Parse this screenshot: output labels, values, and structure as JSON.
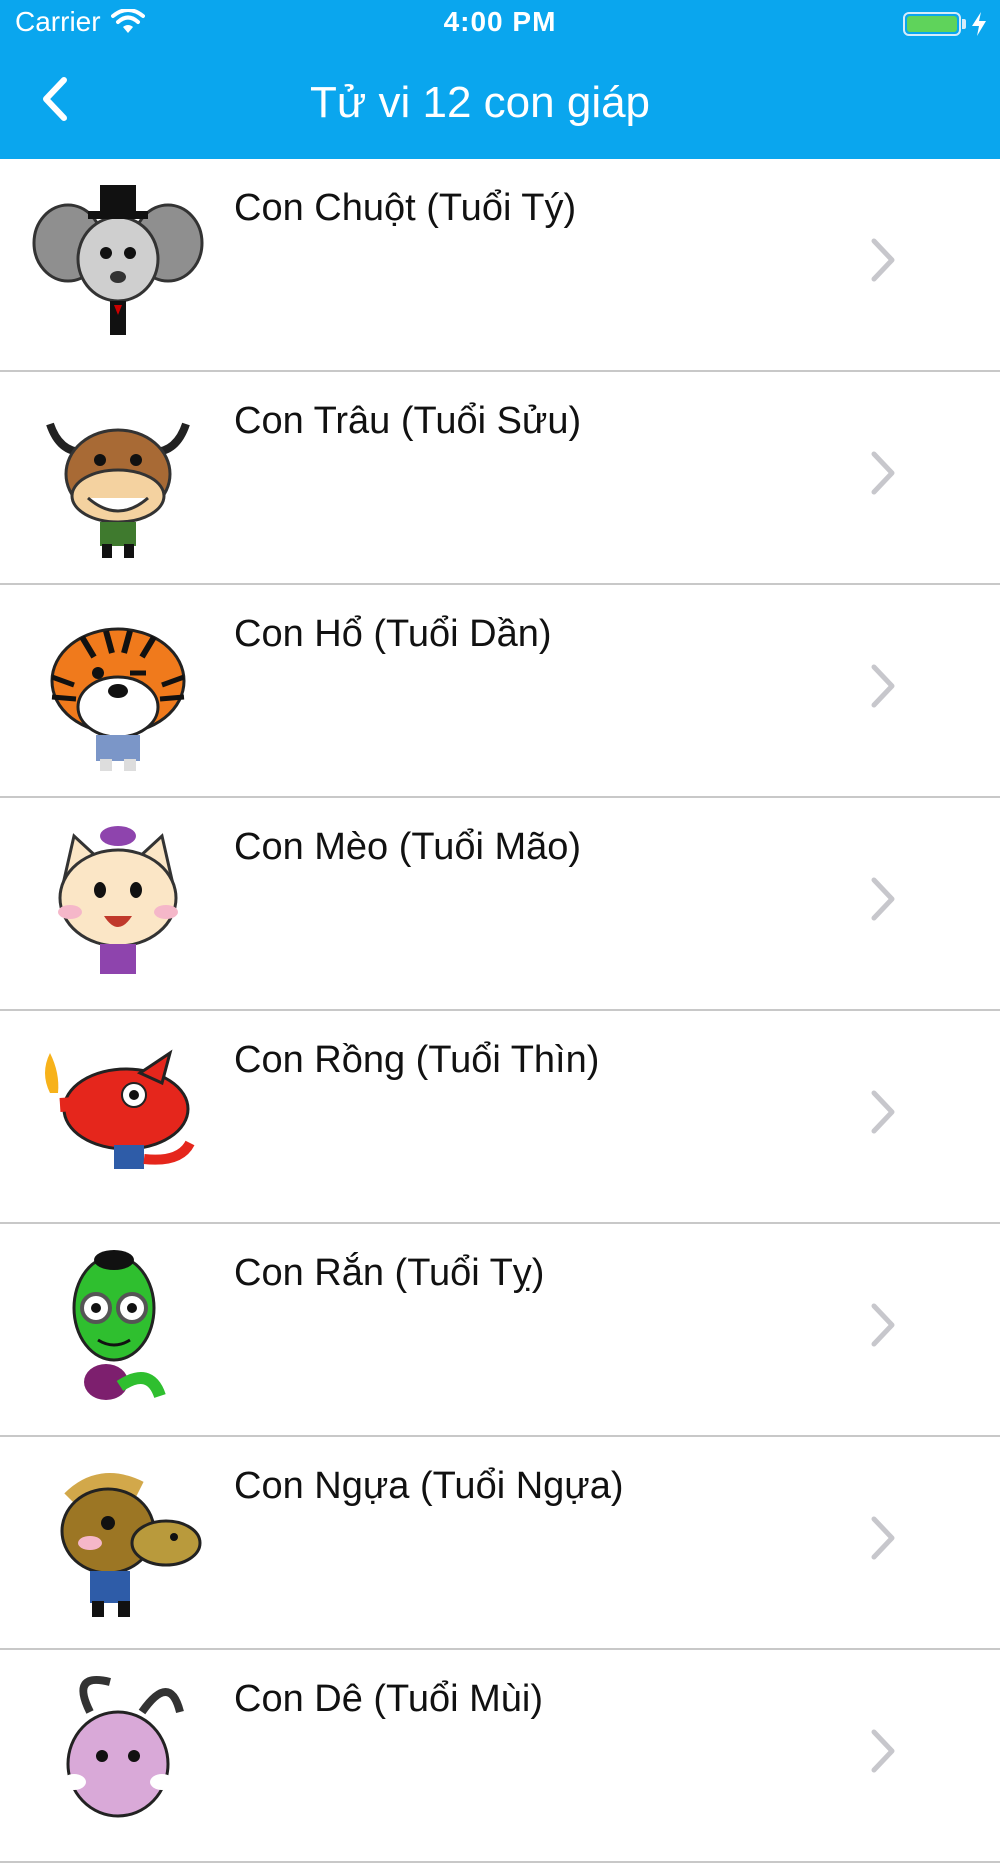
{
  "status_bar": {
    "carrier": "Carrier",
    "time": "4:00 PM",
    "battery_level": 1.0
  },
  "nav": {
    "title": "Tử vi 12 con giáp",
    "back_icon": "chevron-left-icon"
  },
  "colors": {
    "accent": "#0aa6ee",
    "divider": "#c8c8c8",
    "chevron": "#c7c7cc",
    "battery": "#5fd35b"
  },
  "zodiac": [
    {
      "label": "Con Chuột (Tuổi Tý)",
      "icon": "rat-icon"
    },
    {
      "label": "Con Trâu (Tuổi Sửu)",
      "icon": "buffalo-icon"
    },
    {
      "label": "Con Hổ (Tuổi Dần)",
      "icon": "tiger-icon"
    },
    {
      "label": "Con Mèo (Tuổi Mão)",
      "icon": "cat-icon"
    },
    {
      "label": "Con Rồng (Tuổi Thìn)",
      "icon": "dragon-icon"
    },
    {
      "label": "Con Rắn (Tuổi Tỵ)",
      "icon": "snake-icon"
    },
    {
      "label": "Con Ngựa (Tuổi Ngựa)",
      "icon": "horse-icon"
    },
    {
      "label": "Con Dê (Tuổi Mùi)",
      "icon": "goat-icon"
    }
  ]
}
